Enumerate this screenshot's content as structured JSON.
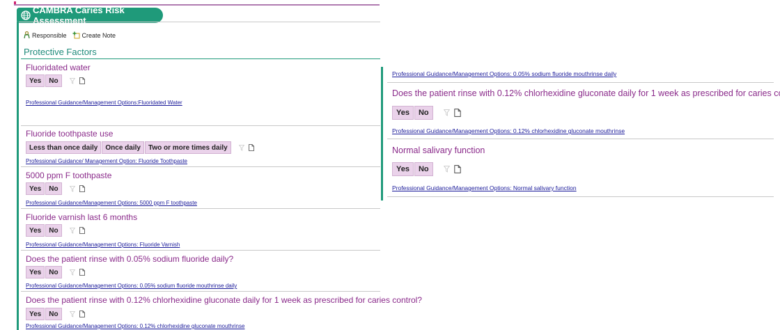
{
  "header": {
    "title": "CAMBRA Caries Risk Assessment"
  },
  "toolbar": {
    "responsible_label": "Responsible",
    "create_note_label": "Create Note"
  },
  "section": {
    "title": "Protective Factors"
  },
  "left_questions": [
    {
      "question": "Fluoridated water",
      "options": [
        "Yes",
        "No"
      ],
      "guidance": "Professional Guidance/Management Options:Fluoridated Water"
    },
    {
      "question": "Fluoride toothpaste use",
      "options": [
        "Less than once daily",
        "Once daily",
        "Two or more times daily"
      ],
      "guidance": "Professional Guidance/  Management Option: Fluoride Toothpaste"
    },
    {
      "question": "5000 ppm F toothpaste",
      "options": [
        "Yes",
        "No"
      ],
      "guidance": "Professional Guidance/Management Options: 5000 ppm F toothpaste"
    },
    {
      "question": "Fluoride varnish last 6 months",
      "options": [
        "Yes",
        "No"
      ],
      "guidance": "Professional Guidance/Management Options: Fluoride Varnish"
    },
    {
      "question": "Does the patient rinse with 0.05% sodium fluoride daily?",
      "options": [
        "Yes",
        "No"
      ],
      "guidance": "Professional Guidance/Management Options: 0.05% sodium fluoride mouthrinse daily"
    },
    {
      "question": "Does the patient rinse with 0.12% chlorhexidine gluconate daily for 1 week as prescribed for caries control?",
      "options": [
        "Yes",
        "No"
      ],
      "guidance": "Professional Guidance/Management Options: 0.12% chlorhexidine gluconate mouthrinse"
    }
  ],
  "right_panel": {
    "top_guidance": "Professional Guidance/Management Options: 0.05% sodium fluoride mouthrinse daily",
    "questions": [
      {
        "question": "Does the patient rinse with 0.12% chlorhexidine gluconate daily for 1 week as prescribed for caries control?",
        "options": [
          "Yes",
          "No"
        ],
        "guidance": "Professional Guidance/Management Options: 0.12% chlorhexidine gluconate mouthrinse"
      },
      {
        "question": "Normal salivary function",
        "options": [
          "Yes",
          "No"
        ],
        "guidance": "Professional Guidance/Management Options: Normal salivary function"
      }
    ]
  },
  "colors": {
    "accent_teal": "#1f9a7a",
    "question_purple": "#8a2a8a",
    "option_bg": "#ead2ea",
    "link_blue": "#1a1a9a"
  },
  "icons": [
    "globe-icon",
    "responsible-person-icon",
    "create-note-icon",
    "filter-icon",
    "note-icon"
  ]
}
